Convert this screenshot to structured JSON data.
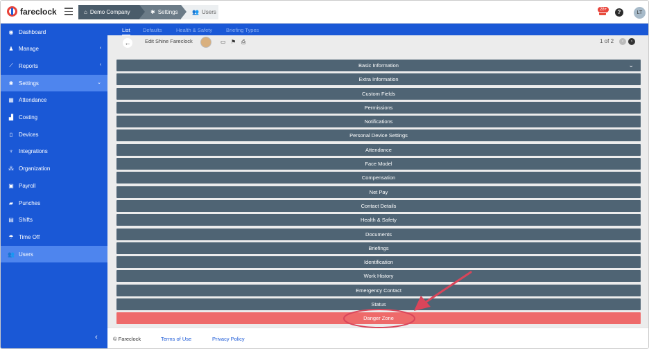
{
  "app": {
    "logo_text": "fareclock"
  },
  "breadcrumb": [
    {
      "label": "Demo Company",
      "icon": "home-icon"
    },
    {
      "label": "Settings",
      "icon": "gear-icon"
    },
    {
      "label": "Users",
      "icon": "users-icon"
    }
  ],
  "header": {
    "notification_count": "28+",
    "help": "?",
    "avatar_initials": "LT"
  },
  "sidebar": {
    "items": [
      {
        "label": "Dashboard",
        "icon": "dashboard-icon"
      },
      {
        "label": "Manage",
        "icon": "person-icon",
        "chevron": "‹"
      },
      {
        "label": "Reports",
        "icon": "chart-icon",
        "chevron": "‹"
      },
      {
        "label": "Settings",
        "icon": "gear-icon",
        "chevron": "⌄",
        "active": true
      },
      {
        "label": "Attendance",
        "icon": "grid-icon"
      },
      {
        "label": "Costing",
        "icon": "bar-chart-icon"
      },
      {
        "label": "Devices",
        "icon": "phone-icon"
      },
      {
        "label": "Integrations",
        "icon": "plug-icon"
      },
      {
        "label": "Organization",
        "icon": "sitemap-icon"
      },
      {
        "label": "Payroll",
        "icon": "money-icon"
      },
      {
        "label": "Punches",
        "icon": "punch-icon"
      },
      {
        "label": "Shifts",
        "icon": "calendar-icon"
      },
      {
        "label": "Time Off",
        "icon": "umbrella-icon"
      },
      {
        "label": "Users",
        "icon": "users-icon",
        "active": true
      }
    ],
    "collapse": "‹"
  },
  "subtabs": [
    "List",
    "Defaults",
    "Health & Safety",
    "Briefing Types"
  ],
  "editor": {
    "title": "Edit Shine Fareclock",
    "pager": "1 of 2"
  },
  "sections": [
    "Basic Information",
    "Extra Information",
    "Custom Fields",
    "Permissions",
    "Notifications",
    "Personal Device Settings",
    "Attendance",
    "Face Model",
    "Compensation",
    "Net Pay",
    "Contact Details",
    "Health & Safety",
    "Documents",
    "Briefings",
    "Identification",
    "Work History",
    "Emergency Contact",
    "Status",
    "Danger Zone"
  ],
  "footer": {
    "copyright": "© Fareclock",
    "terms": "Terms of Use",
    "privacy": "Privacy Policy"
  },
  "colors": {
    "sidebar": "#1a58d6",
    "section": "#4f6474",
    "danger": "#ee6a6a",
    "annotation": "#d9455a"
  }
}
